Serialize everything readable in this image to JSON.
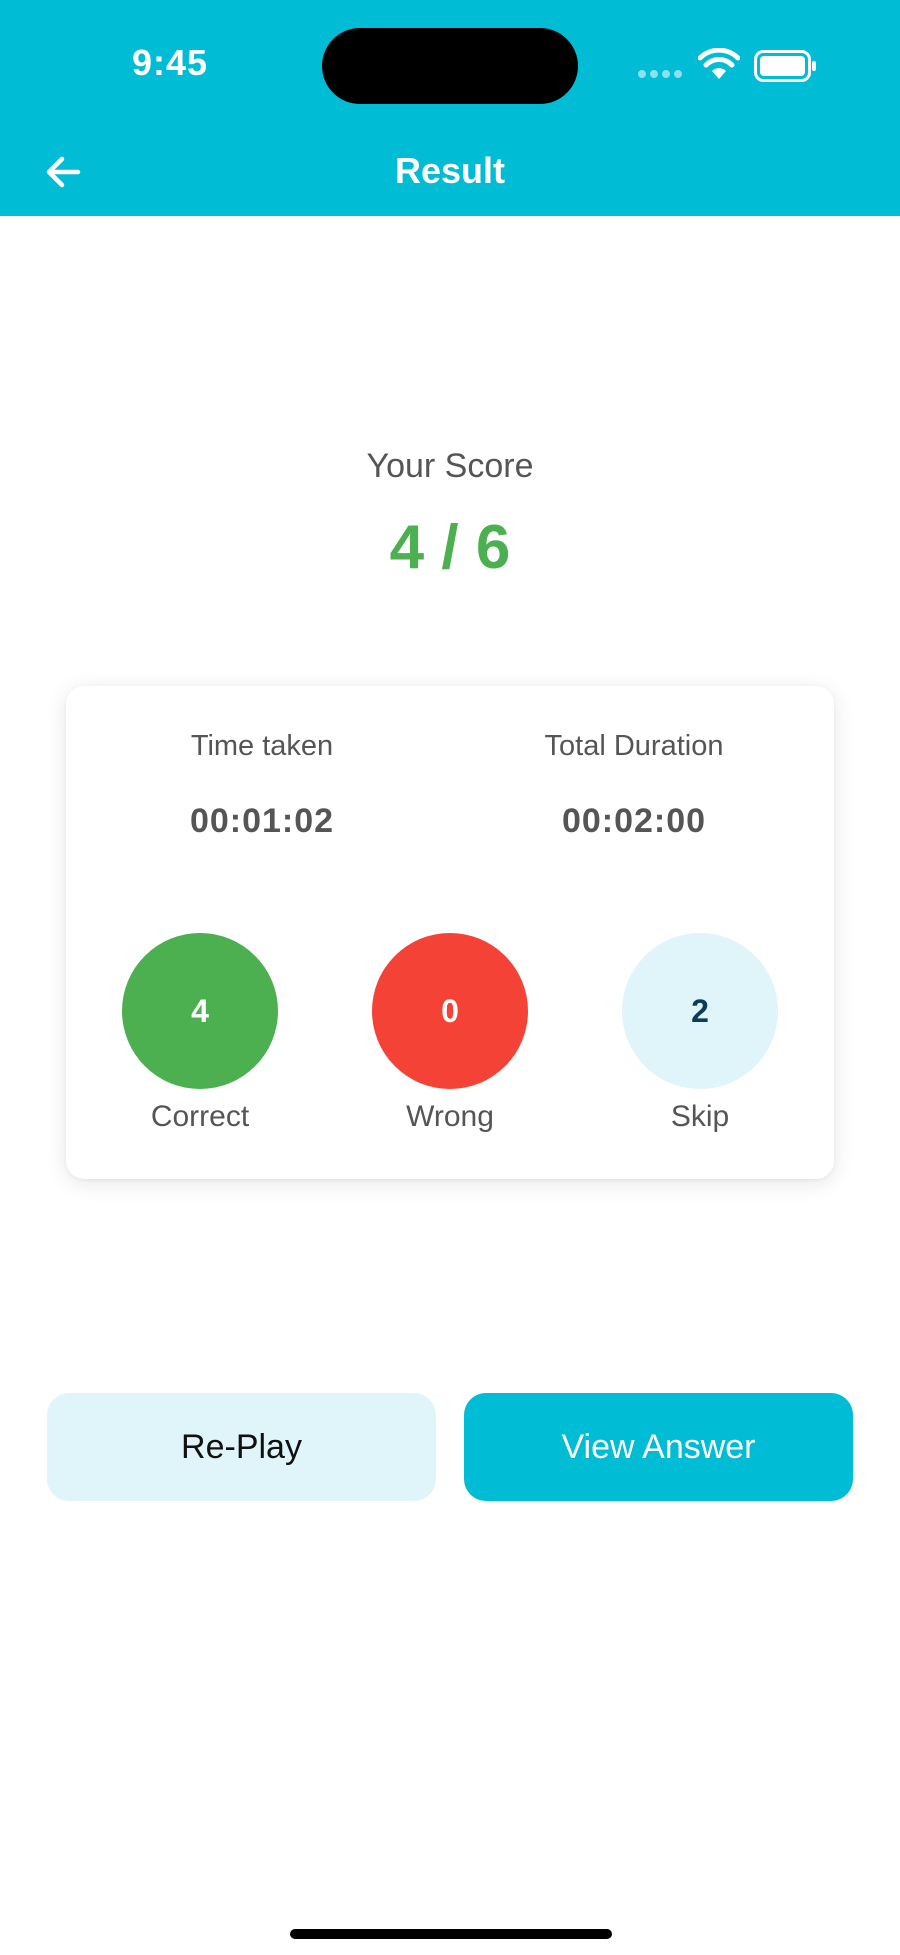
{
  "status_bar": {
    "time": "9:45",
    "icons": [
      "signal-dots-icon",
      "wifi-icon",
      "battery-icon"
    ]
  },
  "header": {
    "title": "Result",
    "back_icon": "arrow-left-icon"
  },
  "score": {
    "label": "Your Score",
    "value": "4 / 6"
  },
  "stats": {
    "time_taken_label": "Time taken",
    "time_taken_value": "00:01:02",
    "total_duration_label": "Total Duration",
    "total_duration_value": "00:02:00"
  },
  "results": {
    "correct": {
      "count": "4",
      "label": "Correct"
    },
    "wrong": {
      "count": "0",
      "label": "Wrong"
    },
    "skip": {
      "count": "2",
      "label": "Skip"
    }
  },
  "actions": {
    "replay_label": "Re-Play",
    "view_answer_label": "View Answer"
  },
  "colors": {
    "primary": "#00BCD4",
    "correct": "#4CAF50",
    "wrong": "#F44336",
    "skip": "#E0F5F9",
    "score_text": "#4CAF50"
  }
}
